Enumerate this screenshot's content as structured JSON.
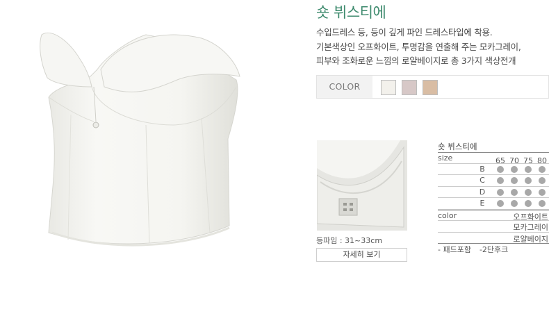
{
  "product": {
    "title": "숏 뷔스티에",
    "description": [
      "수입드레스 등, 등이 깊게 파인 드레스타입에 착용.",
      "기본색상인 오프화이트, 투명감을 연출해 주는 모카그레이,",
      "피부와 조화로운 느낌의 로얄베이지로 총 3가지 색상전개"
    ]
  },
  "colors": {
    "label": "COLOR",
    "swatches": [
      "#f3f1ec",
      "#d7c8c7",
      "#d9bda4"
    ]
  },
  "detail": {
    "caption": "등파임 : 31~33cm",
    "button_label": "자세히 보기"
  },
  "spec": {
    "title": "숏 뷔스티에",
    "size_label": "size",
    "sizes": [
      "65",
      "70",
      "75",
      "80"
    ],
    "cups": [
      "B",
      "C",
      "D",
      "E"
    ],
    "color_label": "color",
    "color_names": [
      "오프화이트",
      "모카그레이",
      "로얄베이지"
    ],
    "notes": [
      "- 패드포함",
      "-2단후크"
    ]
  }
}
